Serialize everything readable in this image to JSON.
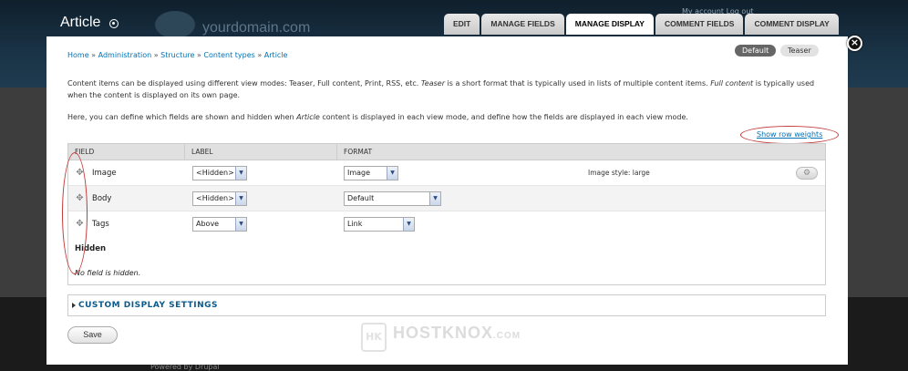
{
  "background": {
    "page_title": "Article",
    "site_domain": "yourdomain.com",
    "account_links": "My account   Log out",
    "footer_text": "Powered by Drupal",
    "tabs": [
      {
        "label": "EDIT",
        "active": false
      },
      {
        "label": "MANAGE FIELDS",
        "active": false
      },
      {
        "label": "MANAGE DISPLAY",
        "active": true
      },
      {
        "label": "COMMENT FIELDS",
        "active": false
      },
      {
        "label": "COMMENT DISPLAY",
        "active": false
      }
    ]
  },
  "modal": {
    "close_icon": "×",
    "breadcrumb": [
      "Home",
      "Administration",
      "Structure",
      "Content types",
      "Article"
    ],
    "breadcrumb_separator": "»",
    "view_modes": [
      {
        "label": "Default",
        "active": true
      },
      {
        "label": "Teaser",
        "active": false
      }
    ],
    "description_1": {
      "part1": "Content items can be displayed using different view modes: Teaser, Full content, Print, RSS, etc. ",
      "em1": "Teaser",
      "part2": " is a short format that is typically used in lists of multiple content items. ",
      "em2": "Full content",
      "part3": " is typically used when the content is displayed on its own page."
    },
    "description_2": {
      "part1": "Here, you can define which fields are shown and hidden when ",
      "em1": "Article",
      "part2": " content is displayed in each view mode, and define how the fields are displayed in each view mode."
    },
    "show_row_weights": "Show row weights",
    "table": {
      "headers": [
        "FIELD",
        "LABEL",
        "FORMAT"
      ],
      "rows": [
        {
          "field": "Image",
          "label": "<Hidden>",
          "format": "Image",
          "summary": "Image style: large",
          "has_settings": true
        },
        {
          "field": "Body",
          "label": "<Hidden>",
          "format": "Default",
          "summary": "",
          "has_settings": false
        },
        {
          "field": "Tags",
          "label": "Above",
          "format": "Link",
          "summary": "",
          "has_settings": false
        }
      ],
      "hidden_heading": "Hidden",
      "hidden_empty": "No field is hidden."
    },
    "custom_display_settings": "CUSTOM DISPLAY SETTINGS",
    "save_label": "Save",
    "watermark": {
      "logo": "HK",
      "name": "HOSTKNOX",
      "suffix": ".COM"
    }
  },
  "colors": {
    "link": "#0071b3",
    "annotation": "#c23b3b",
    "fieldset_title": "#0a5a8c"
  },
  "icons": {
    "drag_handle": "drag-handle-icon",
    "settings": "gear-icon",
    "close": "close-icon",
    "caret": "caret-right-icon"
  }
}
